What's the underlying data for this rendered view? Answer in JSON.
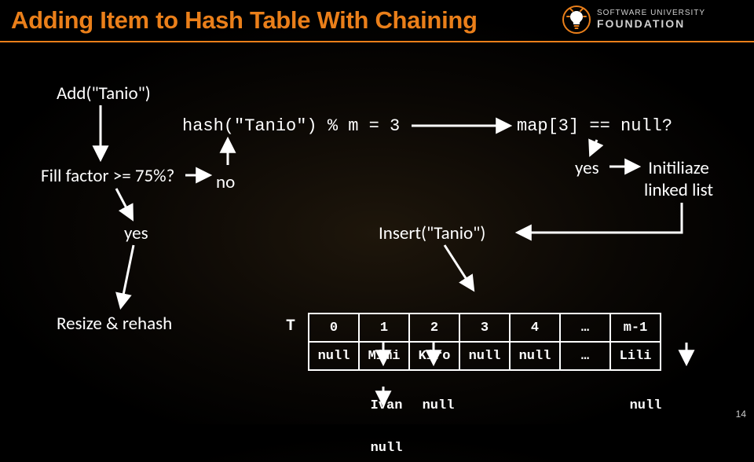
{
  "title": "Adding Item to Hash Table With Chaining",
  "logo": {
    "line1": "SOFTWARE UNIVERSITY",
    "line2": "FOUNDATION"
  },
  "steps": {
    "add_call": "Add(\"Tanio\")",
    "fill_factor_q": "Fill factor >= 75%?",
    "yes1": "yes",
    "resize": "Resize & rehash",
    "no": "no",
    "hash_expr": "hash(\"Tanio\") % m = 3",
    "map_null_q": "map[3] == null?",
    "yes2": "yes",
    "init_list": "Initiliaze\nlinked list",
    "insert": "Insert(\"Tanio\")"
  },
  "table": {
    "label": "T",
    "indices": [
      "0",
      "1",
      "2",
      "3",
      "4",
      "…",
      "m-1"
    ],
    "row": [
      "null",
      "Mimi",
      "Kiro",
      "null",
      "null",
      "…",
      "Lili"
    ],
    "chain1": [
      "",
      "Ivan",
      "null",
      "",
      "",
      "",
      "null"
    ],
    "chain2": [
      "",
      "null",
      "",
      "",
      "",
      "",
      ""
    ]
  },
  "page_number": "14"
}
